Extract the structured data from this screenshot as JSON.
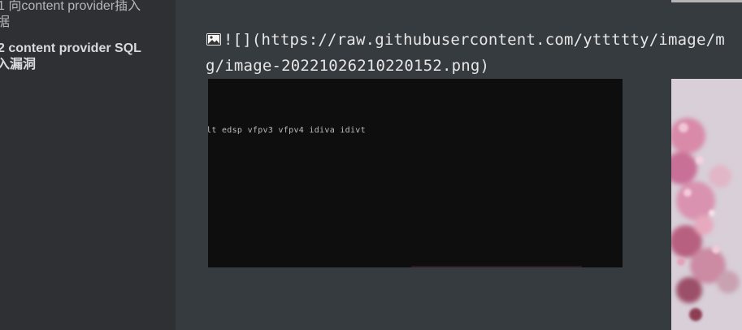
{
  "sidebar": {
    "items": [
      {
        "line1": "1 向content provider插入",
        "line2": "据"
      },
      {
        "line1": "2 content provider SQL",
        "line2": "入漏洞"
      }
    ]
  },
  "main": {
    "markdown_line1": "![](https://raw.githubusercontent.com/yttttty/image/m",
    "markdown_line2": "g/image-20221026210220152.png)",
    "broken_image_icon": "broken-image-icon",
    "terminal_text": "lt edsp vfpv3 vfpv4 idiva idivt"
  },
  "colors": {
    "sidebar_bg": "#2e3033",
    "content_bg": "#363b40",
    "terminal_bg": "#0e0e0e",
    "text": "#e6e6e6"
  }
}
